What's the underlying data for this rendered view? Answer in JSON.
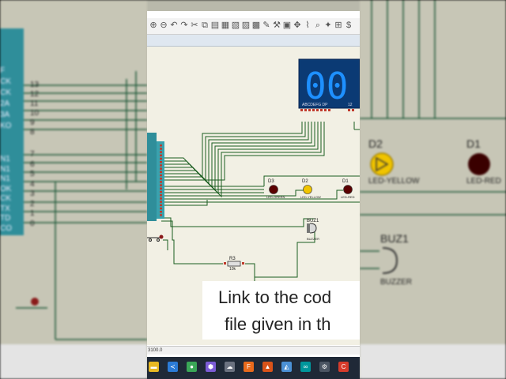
{
  "toolbar": {
    "icons": [
      "zoom-in-icon",
      "zoom-out-icon",
      "undo-icon",
      "redo-icon",
      "cut-icon",
      "copy-icon",
      "paste-icon",
      "block-copy-icon",
      "block-move-icon",
      "block-rotate-icon",
      "block-delete-icon",
      "pick-device-icon",
      "make-device-icon",
      "package-icon",
      "decompose-icon",
      "wire-autoroute-icon",
      "search-icon",
      "property-icon",
      "netlist-icon",
      "bill-icon"
    ]
  },
  "schematic": {
    "display_digits": "00",
    "display_pins_label": "ABCDEFG DP",
    "display_common_label": "12",
    "mcu_right_pins": [
      "13",
      "12",
      "11",
      "10",
      "9",
      "8",
      "7",
      "6",
      "5",
      "4",
      "3",
      "2",
      "1",
      "0"
    ],
    "leds": [
      {
        "ref": "D3",
        "name": "LED-GREEN",
        "color": "#5a0000"
      },
      {
        "ref": "D2",
        "name": "LED-YELLOW",
        "color": "#f0c400"
      },
      {
        "ref": "D1",
        "name": "LED-RED",
        "color": "#5a0000"
      }
    ],
    "buzzer": {
      "ref": "BUZ1",
      "name": "BUZZER"
    },
    "resistor": {
      "ref": "R3",
      "value": "10k"
    }
  },
  "background_left": {
    "pin_labels": [
      "F",
      "CK",
      "CK",
      "2A",
      "3A",
      "KO",
      "N1",
      "N1",
      "N1",
      "OK",
      "CK",
      "TX",
      "TD",
      "CO"
    ],
    "pin_numbers": [
      "13",
      "12",
      "11",
      "10",
      "9",
      "8",
      "7",
      "6",
      "5",
      "4",
      "3",
      "2",
      "1",
      "0"
    ]
  },
  "background_right": {
    "leds": [
      {
        "ref": "D2",
        "name": "LED-YELLOW"
      },
      {
        "ref": "D1",
        "name": "LED-RED"
      }
    ],
    "buzzer": {
      "ref": "BUZ1",
      "name": "BUZZER"
    }
  },
  "caption": {
    "line1": "Link to the cod",
    "line2": "file given in th"
  },
  "status": {
    "coord": "3100.0"
  },
  "taskbar": {
    "apps": [
      {
        "name": "file-explorer-icon",
        "glyph": "▬",
        "color": "#e8b923"
      },
      {
        "name": "vscode-icon",
        "glyph": "≺",
        "color": "#2b7bd6"
      },
      {
        "name": "chrome-icon",
        "glyph": "●",
        "color": "#3aa757"
      },
      {
        "name": "app-hex-icon",
        "glyph": "⬢",
        "color": "#7c5cd6"
      },
      {
        "name": "app-cloud-icon",
        "glyph": "☁",
        "color": "#6b7280"
      },
      {
        "name": "app-f-icon",
        "glyph": "F",
        "color": "#e86a1c"
      },
      {
        "name": "matlab-icon",
        "glyph": "▲",
        "color": "#d95319"
      },
      {
        "name": "app-tri-icon",
        "glyph": "◭",
        "color": "#4b91d6"
      },
      {
        "name": "arduino-icon",
        "glyph": "∞",
        "color": "#00979c"
      },
      {
        "name": "proteus-icon",
        "glyph": "⚙",
        "color": "#4b5563"
      },
      {
        "name": "app-c-icon",
        "glyph": "C",
        "color": "#d63b2b"
      }
    ]
  }
}
